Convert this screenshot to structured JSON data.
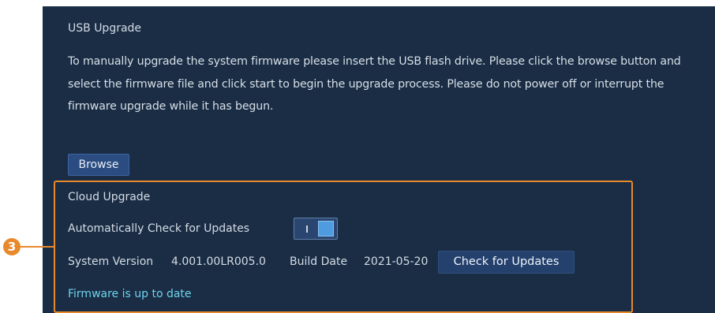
{
  "usb_upgrade": {
    "title": "USB Upgrade",
    "description": "To manually upgrade the system firmware please insert the USB flash drive. Please click the browse button and select the firmware file and click start to begin the upgrade process. Please do not power off or interrupt the firmware upgrade while it has begun.",
    "browse_label": "Browse"
  },
  "cloud_upgrade": {
    "title": "Cloud Upgrade",
    "auto_check_label": "Automatically Check for Updates",
    "auto_check_enabled": true,
    "system_version_label": "System Version",
    "system_version": "4.001.00LR005.0",
    "build_date_label": "Build Date",
    "build_date": "2021-05-20",
    "check_button_label": "Check for Updates",
    "status": "Firmware is up to date"
  },
  "callout": {
    "number": "3"
  },
  "colors": {
    "panel_bg": "#1a2d45",
    "highlight": "#e8892c",
    "status_text": "#6ed3ee",
    "toggle_on": "#4f9be0"
  },
  "icons": {
    "toggle": "toggle-switch-icon"
  }
}
